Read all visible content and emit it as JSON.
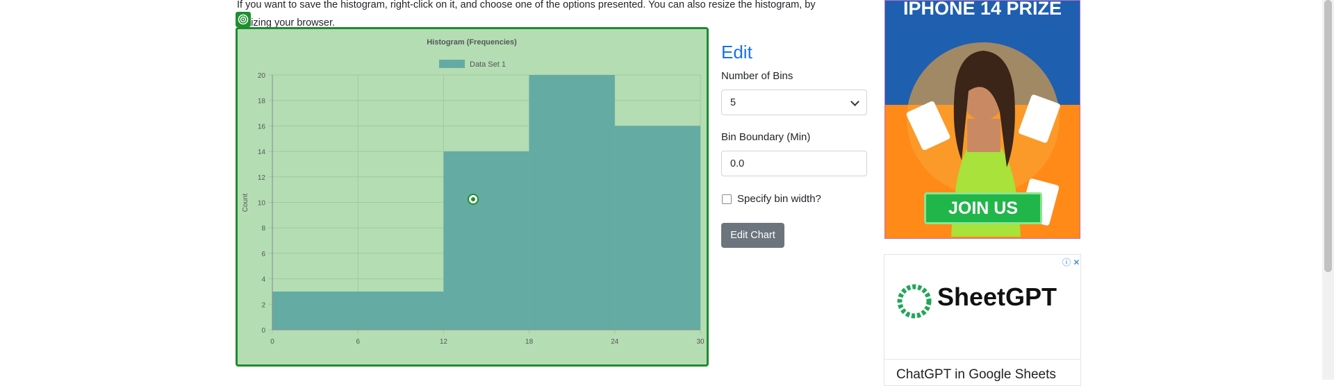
{
  "intro": {
    "line1": "If you want to save the histogram, right-click on it, and choose one of the options presented. You can also resize the histogram, by",
    "line2": "resizing your browser."
  },
  "chart_data": {
    "type": "bar",
    "title": "Histogram (Frequencies)",
    "legend": [
      "Data Set 1"
    ],
    "ylabel": "Count",
    "xlabel": "",
    "x_ticks": [
      0,
      6,
      12,
      18,
      24,
      30
    ],
    "y_ticks": [
      0,
      2,
      4,
      6,
      8,
      10,
      12,
      14,
      16,
      18,
      20
    ],
    "ylim": [
      0,
      20
    ],
    "xlim": [
      0,
      30
    ],
    "bins": [
      {
        "start": 0,
        "end": 12,
        "count": 3
      },
      {
        "start": 12,
        "end": 18,
        "count": 14
      },
      {
        "start": 18,
        "end": 24,
        "count": 20
      },
      {
        "start": 24,
        "end": 30,
        "count": 16
      }
    ],
    "colors": {
      "background": "#b4ddb4",
      "bar": "#64aba4",
      "grid": "#9ccb9c",
      "axis_text": "#555555"
    },
    "grid": true,
    "legend_position": "top"
  },
  "edit": {
    "title": "Edit",
    "bins_label": "Number of Bins",
    "bins_value": "5",
    "boundary_label": "Bin Boundary (Min)",
    "boundary_value": "0.0",
    "width_checkbox_label": "Specify bin width?",
    "button": "Edit Chart"
  },
  "ad1": {
    "heading": "IPHONE 14 PRIZE",
    "button": "JOIN US"
  },
  "ad2": {
    "brand": "SheetGPT",
    "subtitle": "ChatGPT in Google Sheets",
    "adchoices": "ⓘ ✕"
  },
  "accent": "#1a73e8"
}
